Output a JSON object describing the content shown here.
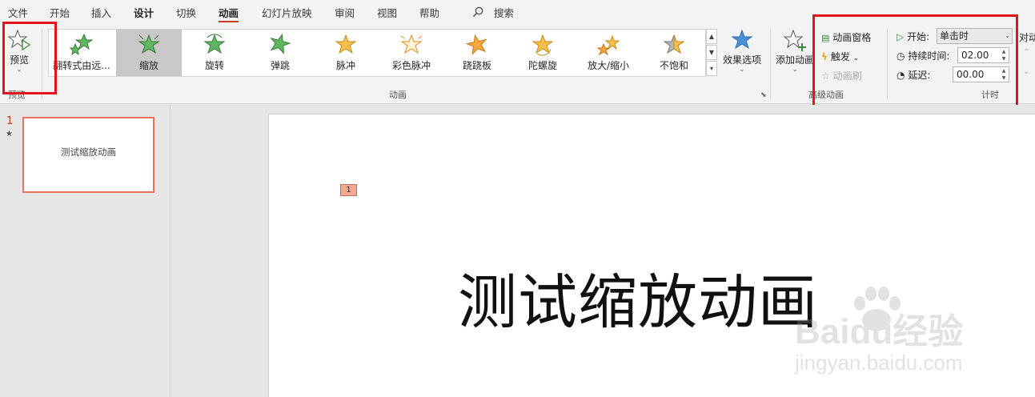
{
  "menu": {
    "tabs": [
      "文件",
      "开始",
      "插入",
      "设计",
      "切换",
      "动画",
      "幻灯片放映",
      "审阅",
      "视图",
      "帮助"
    ],
    "search_label": "搜索"
  },
  "ribbon": {
    "preview": {
      "label": "预览",
      "group_label": "预览"
    },
    "gallery": {
      "group_label": "动画",
      "items": [
        "翻转式由远...",
        "缩放",
        "旋转",
        "弹跳",
        "脉冲",
        "彩色脉冲",
        "跷跷板",
        "陀螺旋",
        "放大/缩小",
        "不饱和"
      ]
    },
    "effect_options_label": "效果选项",
    "add_animation_label": "添加动画",
    "advanced": {
      "group_label": "高级动画",
      "animation_pane": "动画窗格",
      "trigger": "触发",
      "animation_painter": "动画刷"
    },
    "timing": {
      "group_label": "计时",
      "start_label": "开始:",
      "start_value": "单击时",
      "duration_label": "持续时间:",
      "duration_value": "02.00",
      "delay_label": "延迟:",
      "delay_value": "00.00",
      "reorder_label": "对动"
    }
  },
  "slides": {
    "thumbnail": {
      "number": "1",
      "star": "★",
      "text": "测试缩放动画"
    },
    "current": {
      "anim_tag": "1",
      "title": "测试缩放动画"
    }
  },
  "watermark": {
    "text": "Baidu经验",
    "url": "jingyan.baidu.com"
  },
  "colors": {
    "accent": "#c43e1c",
    "highlight_box": "#e3141b",
    "selected_gallery": "#c8c8c8"
  }
}
